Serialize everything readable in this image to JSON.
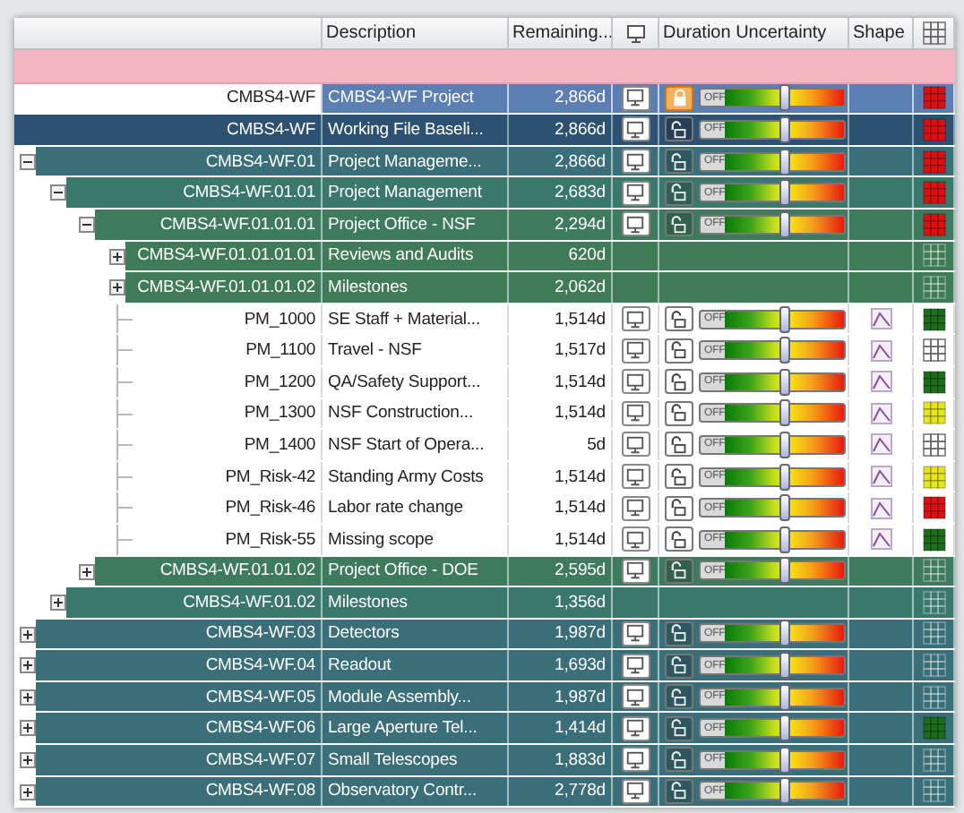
{
  "header": {
    "columns": [
      "Description",
      "Remaining...",
      "Duration Uncertainty",
      "Shape"
    ]
  },
  "rows": [
    {
      "kind": "project",
      "id": "CMBS4-WF",
      "description": "CMBS4-WF Project",
      "remaining": "2,866d",
      "monitor": true,
      "locked": true,
      "slider": {
        "label": "OFF",
        "level": 0.58
      },
      "shape": false,
      "color": "#dd1111"
    },
    {
      "kind": "baseline",
      "id": "CMBS4-WF",
      "description": "Working File Baseli...",
      "remaining": "2,866d",
      "monitor": true,
      "locked": false,
      "slider": {
        "label": "OFF",
        "level": 0.58
      },
      "shape": false,
      "color": "#dd1111",
      "children": [
        {
          "kind": "summary",
          "id": "CMBS4-WF.01",
          "description": "Project Manageme...",
          "remaining": "2,866d",
          "expanded": true,
          "monitor": true,
          "locked": false,
          "slider": {
            "label": "OFF",
            "level": 0.58
          },
          "shape": false,
          "color": "#dd1111",
          "children": [
            {
              "kind": "summary",
              "id": "CMBS4-WF.01.01",
              "description": "Project Management",
              "remaining": "2,683d",
              "expanded": true,
              "monitor": true,
              "locked": false,
              "slider": {
                "label": "OFF",
                "level": 0.58
              },
              "shape": false,
              "color": "#dd1111",
              "children": [
                {
                  "kind": "summary",
                  "id": "CMBS4-WF.01.01.01",
                  "description": "Project Office - NSF",
                  "remaining": "2,294d",
                  "expanded": true,
                  "monitor": true,
                  "locked": false,
                  "slider": {
                    "label": "OFF",
                    "level": 0.58
                  },
                  "shape": false,
                  "color": "#dd1111",
                  "children": [
                    {
                      "kind": "summary",
                      "id": "CMBS4-WF.01.01.01.01",
                      "description": "Reviews and Audits",
                      "remaining": "620d",
                      "expanded": false,
                      "monitor": false,
                      "shape": false
                    },
                    {
                      "kind": "summary",
                      "id": "CMBS4-WF.01.01.01.02",
                      "description": "Milestones",
                      "remaining": "2,062d",
                      "expanded": false,
                      "monitor": false,
                      "shape": false
                    },
                    {
                      "kind": "task",
                      "id": "PM_1000",
                      "description": "SE Staff + Material...",
                      "remaining": "1,514d",
                      "monitor": true,
                      "locked": false,
                      "slider": {
                        "label": "OFF",
                        "level": 0.58
                      },
                      "shape": true,
                      "color": "#1e6e1e"
                    },
                    {
                      "kind": "task",
                      "id": "PM_1100",
                      "description": "Travel - NSF",
                      "remaining": "1,517d",
                      "monitor": true,
                      "locked": false,
                      "slider": {
                        "label": "OFF",
                        "level": 0.58
                      },
                      "shape": true
                    },
                    {
                      "kind": "task",
                      "id": "PM_1200",
                      "description": "QA/Safety Support...",
                      "remaining": "1,514d",
                      "monitor": true,
                      "locked": false,
                      "slider": {
                        "label": "OFF",
                        "level": 0.58
                      },
                      "shape": true,
                      "color": "#1e6e1e"
                    },
                    {
                      "kind": "task",
                      "id": "PM_1300",
                      "description": "NSF Construction...",
                      "remaining": "1,514d",
                      "monitor": true,
                      "locked": false,
                      "slider": {
                        "label": "OFF",
                        "level": 0.58
                      },
                      "shape": true,
                      "color": "#e6e61e"
                    },
                    {
                      "kind": "task",
                      "id": "PM_1400",
                      "description": "NSF Start of Opera...",
                      "remaining": "5d",
                      "monitor": true,
                      "locked": false,
                      "slider": {
                        "label": "OFF",
                        "level": 0.58
                      },
                      "shape": true
                    },
                    {
                      "kind": "task",
                      "id": "PM_Risk-42",
                      "description": "Standing Army Costs",
                      "remaining": "1,514d",
                      "monitor": true,
                      "locked": false,
                      "slider": {
                        "label": "OFF",
                        "level": 0.58
                      },
                      "shape": true,
                      "color": "#e6e61e"
                    },
                    {
                      "kind": "task",
                      "id": "PM_Risk-46",
                      "description": "Labor rate change",
                      "remaining": "1,514d",
                      "monitor": true,
                      "locked": false,
                      "slider": {
                        "label": "OFF",
                        "level": 0.58
                      },
                      "shape": true,
                      "color": "#dd1111"
                    },
                    {
                      "kind": "task",
                      "id": "PM_Risk-55",
                      "description": "Missing scope",
                      "remaining": "1,514d",
                      "monitor": true,
                      "locked": false,
                      "slider": {
                        "label": "OFF",
                        "level": 0.58
                      },
                      "shape": true,
                      "color": "#1e6e1e"
                    }
                  ]
                },
                {
                  "kind": "summary",
                  "id": "CMBS4-WF.01.01.02",
                  "description": "Project Office - DOE",
                  "remaining": "2,595d",
                  "expanded": false,
                  "monitor": true,
                  "locked": false,
                  "slider": {
                    "label": "OFF",
                    "level": 0.58
                  },
                  "shape": false
                }
              ]
            },
            {
              "kind": "summary",
              "id": "CMBS4-WF.01.02",
              "description": "Milestones",
              "remaining": "1,356d",
              "expanded": false,
              "monitor": false,
              "shape": false
            }
          ]
        },
        {
          "kind": "summary",
          "id": "CMBS4-WF.03",
          "description": "Detectors",
          "remaining": "1,987d",
          "expanded": false,
          "monitor": true,
          "locked": false,
          "slider": {
            "label": "OFF",
            "level": 0.58
          },
          "shape": false
        },
        {
          "kind": "summary",
          "id": "CMBS4-WF.04",
          "description": "Readout",
          "remaining": "1,693d",
          "expanded": false,
          "monitor": true,
          "locked": false,
          "slider": {
            "label": "OFF",
            "level": 0.58
          },
          "shape": false
        },
        {
          "kind": "summary",
          "id": "CMBS4-WF.05",
          "description": "Module Assembly...",
          "remaining": "1,987d",
          "expanded": false,
          "monitor": true,
          "locked": false,
          "slider": {
            "label": "OFF",
            "level": 0.58
          },
          "shape": false
        },
        {
          "kind": "summary",
          "id": "CMBS4-WF.06",
          "description": "Large Aperture Tel...",
          "remaining": "1,414d",
          "expanded": false,
          "monitor": true,
          "locked": false,
          "slider": {
            "label": "OFF",
            "level": 0.58
          },
          "shape": false,
          "color": "#1e6e1e"
        },
        {
          "kind": "summary",
          "id": "CMBS4-WF.07",
          "description": "Small Telescopes",
          "remaining": "1,883d",
          "expanded": false,
          "monitor": true,
          "locked": false,
          "slider": {
            "label": "OFF",
            "level": 0.58
          },
          "shape": false
        },
        {
          "kind": "summary",
          "id": "CMBS4-WF.08",
          "description": "Observatory Contr...",
          "remaining": "2,778d",
          "expanded": false,
          "monitor": true,
          "locked": false,
          "slider": {
            "label": "OFF",
            "level": 0.58
          },
          "shape": false
        }
      ]
    }
  ]
}
